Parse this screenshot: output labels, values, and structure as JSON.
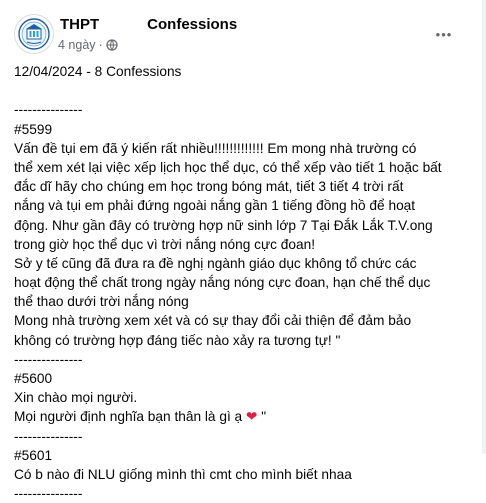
{
  "post": {
    "page_name": "THPT",
    "page_name_suffix": "Confessions",
    "time_ago": "4 ngày",
    "separator_dot": "·",
    "privacy_icon": "globe-icon",
    "more_icon": "more-horizontal-icon",
    "more_label": "•••"
  },
  "content": {
    "lines": [
      "12/04/2024 - 8 Confessions",
      "---------------",
      "#5599",
      "Vấn đề tụi em đã ý kiến rất nhiều!!!!!!!!!!!!!     Em mong nhà trường có",
      "thể xem xét lại việc xếp lịch học thể dục, có thể xếp vào tiết 1 hoặc bất",
      "đắc dĩ hãy cho chúng em học trong bóng mát, tiết 3 tiết 4 trời rất",
      "nắng và tụi em phải đứng ngoài nắng gần 1 tiếng đồng hồ để hoạt",
      "động. Như gần đây có trường hợp nữ sinh lớp 7 Tại Đắk Lắk T.V.ong",
      "trong giờ học thể dục vì trời nắng nóng cực đoan!",
      "Sở y tế cũng đã đưa ra đề nghị ngành giáo dục không tổ chức các",
      "hoạt động thể chất trong ngày nắng nóng cực đoan, hạn chế thể dục",
      "thể thao dưới trời nắng nóng",
      "Mong nhà trường xem xét và có sự thay đổi cải thiện để đảm bảo",
      "không có trường hợp đáng tiếc nào xảy ra tương tự! \"",
      "---------------",
      "#5600",
      "Xin chào mọi người.",
      "---------------",
      "#5601",
      "Có b nào đi NLU giống mình thì cmt cho mình biết nhaa",
      "---------------"
    ],
    "heart_line": {
      "before": "Mọi người định nghĩa bạn thân là gì ạ ",
      "emoji": "❤",
      "after": " \""
    },
    "heart_color": "#e41e3f"
  }
}
